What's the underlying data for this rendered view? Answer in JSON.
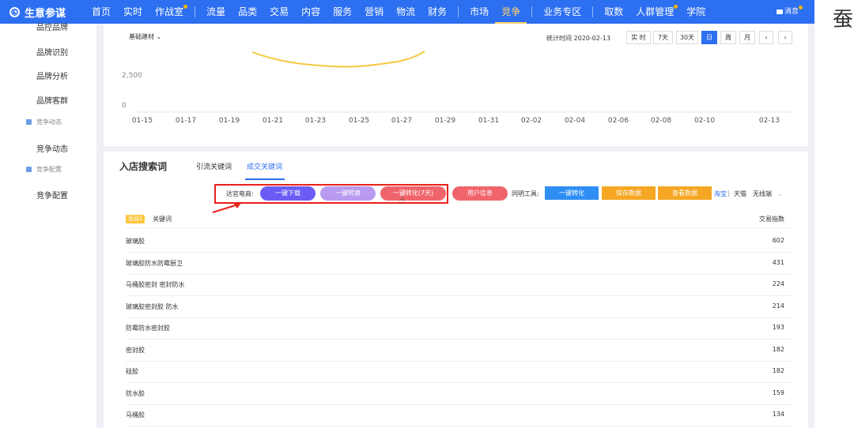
{
  "app": {
    "name": "生意参谋"
  },
  "nav": {
    "items": [
      {
        "label": "首页"
      },
      {
        "label": "实时"
      },
      {
        "label": "作战室",
        "dot": true
      },
      {
        "label": "流量"
      },
      {
        "label": "品类"
      },
      {
        "label": "交易"
      },
      {
        "label": "内容"
      },
      {
        "label": "服务"
      },
      {
        "label": "营销"
      },
      {
        "label": "物流"
      },
      {
        "label": "财务"
      },
      {
        "label": "市场"
      },
      {
        "label": "竞争",
        "active": true
      },
      {
        "label": "业务专区"
      },
      {
        "label": "取数"
      },
      {
        "label": "人群管理",
        "dot": true
      },
      {
        "label": "学院"
      }
    ],
    "message": "消息",
    "message_dot": true
  },
  "side_glyph": "蚕",
  "sidebar": {
    "items": [
      {
        "label": "品控品牌",
        "type": "item"
      },
      {
        "label": "品牌识别",
        "type": "item"
      },
      {
        "label": "品牌分析",
        "type": "item"
      },
      {
        "label": "品牌客群",
        "type": "item"
      },
      {
        "label": "竞争动态",
        "type": "group"
      },
      {
        "label": "竞争动态",
        "type": "item"
      },
      {
        "label": "竞争配置",
        "type": "group"
      },
      {
        "label": "竞争配置",
        "type": "item"
      }
    ]
  },
  "filters": {
    "category": "基础建材",
    "stat_time": "统计时间 2020-02-13",
    "periods": [
      "实 时",
      "7天",
      "30天",
      "日",
      "周",
      "月"
    ],
    "active_period": "日",
    "prev": "‹",
    "next": "›"
  },
  "chart_data": {
    "type": "line",
    "y_ticks": [
      "2,500",
      "0"
    ],
    "x": [
      "01-15",
      "01-17",
      "01-19",
      "01-21",
      "01-23",
      "01-25",
      "01-27",
      "01-29",
      "01-31",
      "02-02",
      "02-04",
      "02-06",
      "02-08",
      "02-10",
      "02-13"
    ],
    "series": [
      {
        "color": "#f5c842",
        "partial": true
      }
    ]
  },
  "keywords": {
    "title": "入店搜索词",
    "tabs": [
      {
        "label": "引流关键词",
        "active": false
      },
      {
        "label": "成交关键词",
        "active": true
      }
    ],
    "tool1_label": "达官电商:",
    "buttons1": [
      {
        "label": "一键下载",
        "color": "#6a5cf5"
      },
      {
        "label": "一键转换",
        "color": "#b89bf0"
      },
      {
        "label": "一键转化(7天)",
        "color": "#f0646b"
      },
      {
        "label": "用户信息",
        "color": "#f0646b"
      }
    ],
    "tool2_label": "同明工具:",
    "buttons2": [
      {
        "label": "一键转化",
        "color": "#2f8ef4"
      },
      {
        "label": "保存数据",
        "color": "#f5a623"
      },
      {
        "label": "查看数据",
        "color": "#f5a623"
      }
    ],
    "platform_links": {
      "taobao": "淘宝",
      "sep": "|",
      "tmall": "天猫",
      "wireless": "无线端"
    },
    "table": {
      "badge": "竞品1",
      "col_keyword": "关键词",
      "col_index": "交易指数",
      "rows": [
        {
          "keyword": "玻璃胶",
          "value": "602"
        },
        {
          "keyword": "玻璃胶防水防霉厨卫",
          "value": "431"
        },
        {
          "keyword": "马桶胶密封 密封防水",
          "value": "224"
        },
        {
          "keyword": "玻璃胶密封胶 防水",
          "value": "214"
        },
        {
          "keyword": "防霉防水密封胶",
          "value": "193"
        },
        {
          "keyword": "密封胶",
          "value": "182"
        },
        {
          "keyword": "硅胶",
          "value": "182"
        },
        {
          "keyword": "防水胶",
          "value": "159"
        },
        {
          "keyword": "马桶胶",
          "value": "134"
        }
      ]
    }
  }
}
